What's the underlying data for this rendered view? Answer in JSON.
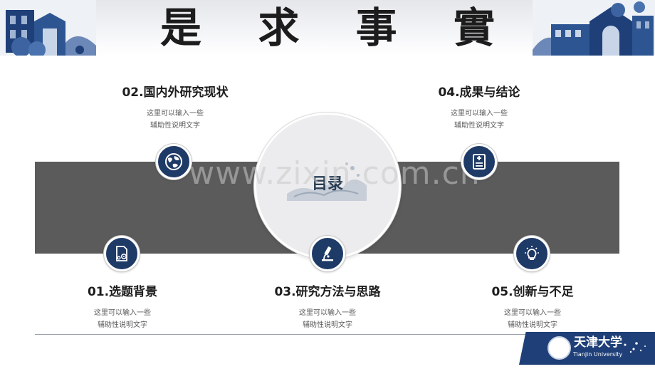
{
  "header": {
    "motto": [
      "是",
      "求",
      "事",
      "實"
    ]
  },
  "center": {
    "title": "目录"
  },
  "watermark": "www.zixin.com.cn",
  "items": [
    {
      "title": "01.选题背景",
      "desc_line1": "这里可以输入一些",
      "desc_line2": "辅助性说明文字",
      "icon": "gear-document-icon"
    },
    {
      "title": "02.国内外研究现状",
      "desc_line1": "这里可以输入一些",
      "desc_line2": "辅助性说明文字",
      "icon": "globe-icon"
    },
    {
      "title": "03.研究方法与思路",
      "desc_line1": "这里可以输入一些",
      "desc_line2": "辅助性说明文字",
      "icon": "microscope-icon"
    },
    {
      "title": "04.成果与结论",
      "desc_line1": "这里可以输入一些",
      "desc_line2": "辅助性说明文字",
      "icon": "report-icon"
    },
    {
      "title": "05.创新与不足",
      "desc_line1": "这里可以输入一些",
      "desc_line2": "辅助性说明文字",
      "icon": "lightbulb-icon"
    }
  ],
  "footer": {
    "university_cn": "天津大学",
    "university_en": "Tianjin University"
  },
  "colors": {
    "navy": "#1e3a66",
    "band_gray": "#5b5b5b",
    "footer_blue": "#1f3f78"
  }
}
